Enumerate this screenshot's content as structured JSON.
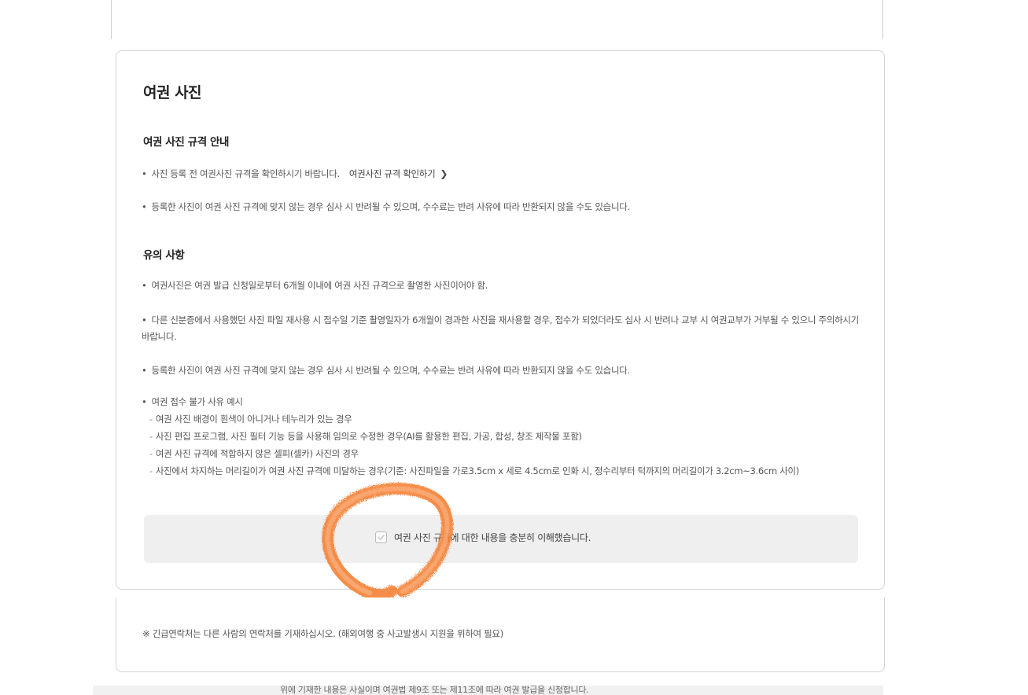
{
  "card": {
    "title": "여권 사진",
    "spec_section": {
      "title": "여권 사진 규격 안내",
      "bullet1_text": "사진 등록 전 여권사진 규격을 확인하시기 바랍니다.",
      "bullet1_link": "여권사진 규격 확인하기",
      "bullet2": "등록한 사진이 여권 사진 규격에 맞지 않는 경우 심사 시 반려될 수 있으며, 수수료는 반려 사유에 따라 반환되지 않을 수도 있습니다."
    },
    "notice_section": {
      "title": "유의 사항",
      "bullets": [
        "여권사진은 여권 발급 신청일로부터 6개월 이내에 여권 사진 규격으로 촬영한 사진이어야 함.",
        "다른 신분증에서 사용했던 사진 파일 재사용 시 접수일 기준 촬영일자가 6개월이 경과한 사진을 재사용할 경우, 접수가 되었더라도 심사 시 반려나 교부 시 여권교부가 거부될 수 있으니 주의하시기 바랍니다.",
        "등록한 사진이 여권 사진 규격에 맞지 않는 경우 심사 시 반려될 수 있으며, 수수료는 반려 사유에 따라 반환되지 않을 수도 있습니다."
      ],
      "examples_title": "여권 접수 불가 사유 예시",
      "examples": [
        "여권 사진 배경이 흰색이 아니거나 테누리가 있는 경우",
        "사진 편집 프로그램, 사진 필터 기능 등을 사용해 임의로 수정한 경우(AI를 활용한 편집, 가공, 합성, 창조 제작물 포함)",
        "여권 사진 규격에 적합하지 않은 셀피(셀카) 사진의 경우",
        "사진에서 차지하는 머리길이가 여권 사진 규격에 미달하는 경우(기준: 사진파일을 가로3.5cm x 세로 4.5cm로 인화 시, 정수리부터 턱까지의 머리길이가 3.2cm~3.6cm 사이)"
      ]
    },
    "agreement": {
      "label": "여권 사진 규격에 대한 내용을 충분히 이해했습니다.",
      "checked": false
    }
  },
  "bottom_panel": {
    "note": "※ 긴급연락처는 다른 사람의 연락처를 기재하십시오. (해외여행 중 사고발생시 지원을 위하여 필요)"
  },
  "footer": {
    "text": "위에 기재한 내용은 사실이며 여권법 제9조 또는 제11조에 따라 여권 발급을 신청합니다."
  },
  "colors": {
    "annotation_orange": "#f47a2c",
    "agree_box_bg": "#efefef"
  },
  "icons": {
    "link_chevron": "chevron-right-icon",
    "checkbox_mark": "check-icon"
  }
}
